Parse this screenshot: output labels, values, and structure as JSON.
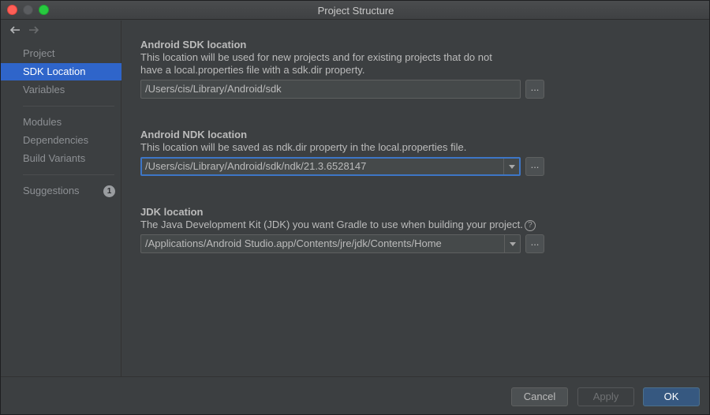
{
  "window": {
    "title": "Project Structure"
  },
  "sidebar": {
    "items": [
      {
        "label": "Project",
        "selected": false
      },
      {
        "label": "SDK Location",
        "selected": true
      },
      {
        "label": "Variables",
        "selected": false
      },
      {
        "label": "Modules",
        "selected": false
      },
      {
        "label": "Dependencies",
        "selected": false
      },
      {
        "label": "Build Variants",
        "selected": false
      },
      {
        "label": "Suggestions",
        "selected": false,
        "badge": "1"
      }
    ]
  },
  "sdk": {
    "title": "Android SDK location",
    "desc_line1": "This location will be used for new projects and for existing projects that do not",
    "desc_line2": "have a local.properties file with a sdk.dir property.",
    "path": "/Users/cis/Library/Android/sdk",
    "browse": "..."
  },
  "ndk": {
    "title": "Android NDK location",
    "desc": "This location will be saved as ndk.dir property in the local.properties file.",
    "path": "/Users/cis/Library/Android/sdk/ndk/21.3.6528147",
    "browse": "..."
  },
  "jdk": {
    "title": "JDK location",
    "desc": "The Java Development Kit (JDK) you want Gradle to use when building your project.",
    "help": "?",
    "path": "/Applications/Android Studio.app/Contents/jre/jdk/Contents/Home",
    "browse": "..."
  },
  "footer": {
    "cancel": "Cancel",
    "apply": "Apply",
    "ok": "OK"
  },
  "colors": {
    "accent": "#2f65ca",
    "background": "#3c3f41",
    "focus_border": "#3d76c6",
    "ok_button": "#365880"
  },
  "icons": {
    "back": "arrow-left-icon",
    "forward": "arrow-right-icon",
    "help": "question-circle-icon",
    "dropdown": "chevron-down-icon"
  }
}
